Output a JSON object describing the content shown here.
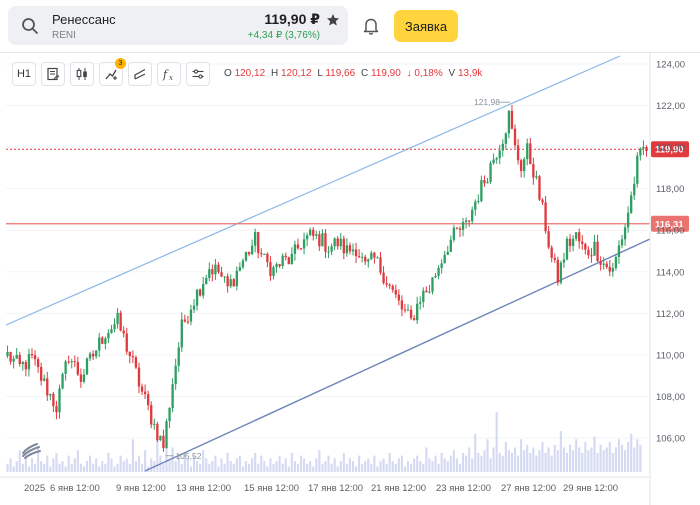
{
  "header": {
    "ticker_name": "Ренессанс",
    "ticker_code": "RENI",
    "price": "119,90 ₽",
    "change": "+4,34 ₽ (3,76%)",
    "order_button": "Заявка"
  },
  "toolbar": {
    "interval": "H1",
    "indicators_badge": "3"
  },
  "ohlc": {
    "o_key": "O",
    "o_val": "120,12",
    "h_key": "H",
    "h_val": "120,12",
    "l_key": "L",
    "l_val": "119,66",
    "c_key": "C",
    "c_val": "119,90",
    "chg": "↓ 0,18%",
    "v_key": "V",
    "v_val": "13,9k"
  },
  "colors": {
    "up": "#2e9e62",
    "down": "#e0393e",
    "accent": "#ffd43c",
    "channel_upper": "#88b8e8",
    "channel_lower": "#6e84b8",
    "level": "#e9736f",
    "volume": "#d4daf2"
  },
  "chart_data": {
    "type": "candlestick",
    "y_ticks": [
      "124,00",
      "122,00",
      "120,00",
      "118,00",
      "116,00",
      "114,00",
      "112,00",
      "110,00",
      "108,00",
      "106,00"
    ],
    "ylim": [
      104.4,
      124.8
    ],
    "x_ticks": [
      "2025",
      "6 янв 12:00",
      "9 янв 12:00",
      "13 янв 12:00",
      "15 янв 12:00",
      "17 янв 12:00",
      "21 янв 12:00",
      "23 янв 12:00",
      "27 янв 12:00",
      "29 янв 12:00"
    ],
    "last_price_label": "119,90",
    "last_price": 119.9,
    "level_label": "116,31",
    "level": 116.31,
    "max_marker": "121,98",
    "min_marker": "105,52",
    "keypoints": [
      [
        0,
        110.0
      ],
      [
        4,
        109.4
      ],
      [
        8,
        109.8
      ],
      [
        12,
        108.6
      ],
      [
        16,
        107.5
      ],
      [
        20,
        110.0
      ],
      [
        24,
        108.9
      ],
      [
        28,
        110.0
      ],
      [
        32,
        111.1
      ],
      [
        36,
        111.6
      ],
      [
        40,
        110.0
      ],
      [
        44,
        108.2
      ],
      [
        48,
        106.6
      ],
      [
        51,
        105.6
      ],
      [
        54,
        108.7
      ],
      [
        57,
        111.3
      ],
      [
        60,
        112.4
      ],
      [
        63,
        113.3
      ],
      [
        66,
        114.2
      ],
      [
        69,
        114.0
      ],
      [
        72,
        113.2
      ],
      [
        75,
        114.0
      ],
      [
        78,
        114.8
      ],
      [
        81,
        115.5
      ],
      [
        84,
        114.5
      ],
      [
        87,
        114.1
      ],
      [
        90,
        114.5
      ],
      [
        93,
        114.6
      ],
      [
        96,
        115.4
      ],
      [
        99,
        115.7
      ],
      [
        102,
        115.6
      ],
      [
        105,
        115.2
      ],
      [
        108,
        115.4
      ],
      [
        111,
        115.0
      ],
      [
        114,
        115.2
      ],
      [
        117,
        114.2
      ],
      [
        120,
        114.6
      ],
      [
        123,
        113.9
      ],
      [
        126,
        113.0
      ],
      [
        129,
        112.2
      ],
      [
        132,
        111.6
      ],
      [
        135,
        112.8
      ],
      [
        138,
        113.2
      ],
      [
        141,
        114.3
      ],
      [
        144,
        115.3
      ],
      [
        147,
        115.9
      ],
      [
        150,
        116.2
      ],
      [
        153,
        117.4
      ],
      [
        156,
        118.4
      ],
      [
        159,
        119.5
      ],
      [
        162,
        120.5
      ],
      [
        164,
        121.5
      ],
      [
        166,
        119.9
      ],
      [
        168,
        119.1
      ],
      [
        170,
        119.8
      ],
      [
        172,
        118.9
      ],
      [
        174,
        117.6
      ],
      [
        176,
        116.2
      ],
      [
        178,
        114.6
      ],
      [
        180,
        113.7
      ],
      [
        183,
        115.3
      ],
      [
        186,
        115.7
      ],
      [
        189,
        114.9
      ],
      [
        192,
        115.2
      ],
      [
        195,
        114.4
      ],
      [
        198,
        114.0
      ],
      [
        200,
        115.2
      ],
      [
        202,
        116.2
      ],
      [
        204,
        117.6
      ],
      [
        206,
        119.2
      ],
      [
        208,
        119.9
      ]
    ],
    "volumes": [
      3,
      5,
      2,
      4,
      8,
      3,
      6,
      2,
      5,
      3,
      9,
      4,
      3,
      6,
      2,
      5,
      7,
      3,
      4,
      2,
      6,
      3,
      5,
      8,
      3,
      2,
      4,
      6,
      3,
      5,
      2,
      4,
      3,
      7,
      5,
      2,
      3,
      6,
      4,
      5,
      3,
      12,
      4,
      6,
      3,
      8,
      2,
      5,
      4,
      14,
      6,
      3,
      18,
      5,
      9,
      4,
      6,
      3,
      7,
      5,
      2,
      6,
      4,
      3,
      8,
      5,
      3,
      4,
      6,
      2,
      5,
      3,
      7,
      4,
      3,
      5,
      6,
      2,
      4,
      3,
      5,
      7,
      3,
      6,
      4,
      2,
      5,
      3,
      4,
      6,
      3,
      5,
      2,
      7,
      4,
      3,
      6,
      5,
      3,
      4,
      2,
      5,
      8,
      3,
      4,
      6,
      3,
      5,
      2,
      4,
      7,
      3,
      5,
      4,
      2,
      6,
      3,
      4,
      5,
      3,
      6,
      2,
      4,
      5,
      3,
      7,
      4,
      3,
      5,
      6,
      2,
      4,
      3,
      5,
      6,
      4,
      3,
      9,
      5,
      4,
      6,
      3,
      7,
      5,
      4,
      6,
      8,
      5,
      3,
      7,
      6,
      9,
      5,
      14,
      7,
      6,
      8,
      12,
      5,
      9,
      22,
      7,
      6,
      11,
      8,
      7,
      9,
      6,
      12,
      8,
      10,
      7,
      9,
      6,
      8,
      11,
      7,
      9,
      6,
      10,
      8,
      15,
      9,
      7,
      10,
      8,
      12,
      9,
      7,
      11,
      8,
      9,
      13,
      7,
      10,
      8,
      9,
      11,
      7,
      9,
      12,
      10,
      8,
      11,
      14,
      9,
      12,
      10
    ]
  }
}
